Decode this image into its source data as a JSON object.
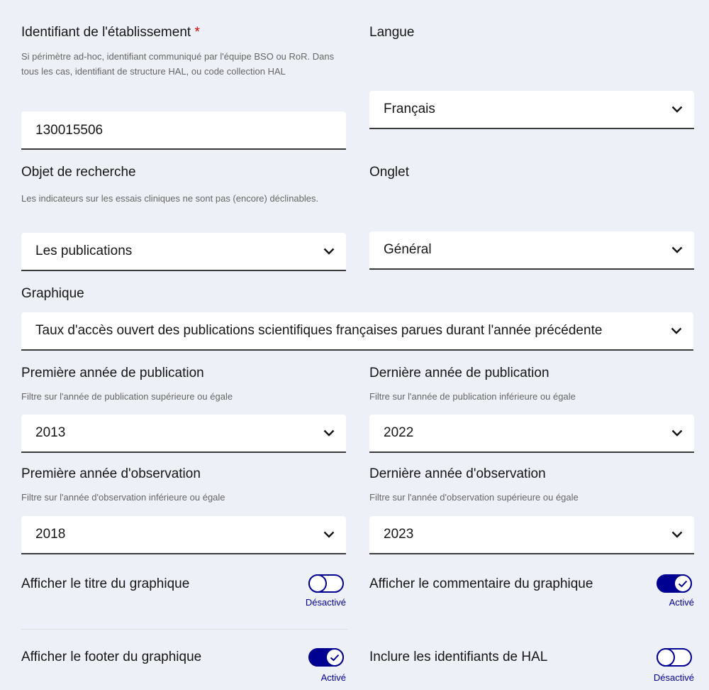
{
  "establishment": {
    "label": "Identifiant de l'établissement",
    "required_mark": "*",
    "hint": "Si périmètre ad-hoc, identifiant communiqué par l'équipe BSO ou RoR. Dans tous les cas, identifiant de structure HAL, ou code collection HAL",
    "value": "130015506"
  },
  "language": {
    "label": "Langue",
    "value": "Français"
  },
  "research_object": {
    "label": "Objet de recherche",
    "hint": "Les indicateurs sur les essais cliniques ne sont pas (encore) déclinables.",
    "value": "Les publications"
  },
  "tab": {
    "label": "Onglet",
    "value": "Général"
  },
  "chart": {
    "label": "Graphique",
    "value": "Taux d'accès ouvert des publications scientifiques françaises parues durant l'année précédente"
  },
  "first_pub_year": {
    "label": "Première année de publication",
    "hint": "Filtre sur l'année de publication supérieure ou égale",
    "value": "2013"
  },
  "last_pub_year": {
    "label": "Dernière année de publication",
    "hint": "Filtre sur l'année de publication inférieure ou égale",
    "value": "2022"
  },
  "first_obs_year": {
    "label": "Première année d'observation",
    "hint": "Filtre sur l'année d'observation inférieure ou égale",
    "value": "2018"
  },
  "last_obs_year": {
    "label": "Dernière année d'observation",
    "hint": "Filtre sur l'année d'observation supérieure ou égale",
    "value": "2023"
  },
  "toggles": {
    "title": {
      "label": "Afficher le titre du graphique",
      "state": "Désactivé",
      "on": false
    },
    "comment": {
      "label": "Afficher le commentaire du graphique",
      "state": "Activé",
      "on": true
    },
    "footer": {
      "label": "Afficher le footer du graphique",
      "state": "Activé",
      "on": true
    },
    "hal_ids": {
      "label": "Inclure les identifiants de HAL",
      "state": "Désactivé",
      "on": false
    }
  },
  "colors": {
    "accent": "#000091",
    "background": "#eef0f8",
    "required": "#ce0500"
  }
}
